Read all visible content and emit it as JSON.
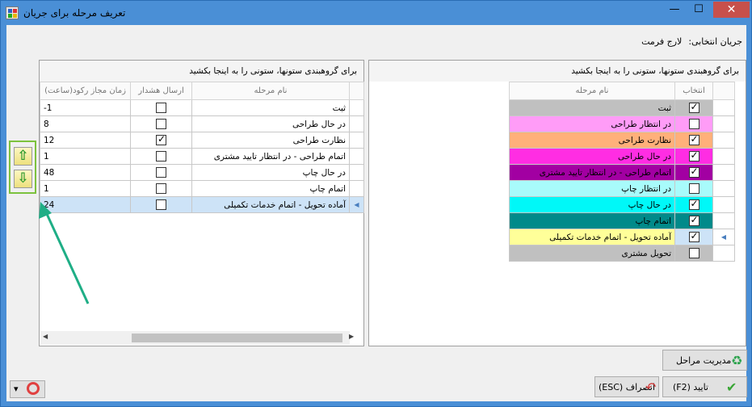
{
  "window": {
    "title": "تعریف مرحله برای جریان",
    "minimize_glyph": "—",
    "maximize_glyph": "☐",
    "close_glyph": "✕"
  },
  "flow": {
    "label": "جریان انتخابی:",
    "value": "لارج فرمت"
  },
  "left_grid": {
    "group_hint": "برای گروهبندی ستونها، ستونی را به اینجا بکشید",
    "columns": [
      "زمان مجاز رکود(ساعت)",
      "ارسال هشدار",
      "نام مرحله"
    ],
    "rows": [
      {
        "time": "-1",
        "alert": false,
        "name": "ثبت"
      },
      {
        "time": "8",
        "alert": false,
        "name": "در حال طراحی"
      },
      {
        "time": "12",
        "alert": true,
        "name": "نظارت طراحی"
      },
      {
        "time": "1",
        "alert": false,
        "name": "اتمام طراحی - در انتظار تایید مشتری"
      },
      {
        "time": "48",
        "alert": false,
        "name": "در حال چاپ"
      },
      {
        "time": "1",
        "alert": false,
        "name": "اتمام چاپ"
      },
      {
        "time": "24",
        "alert": false,
        "name": "آماده تحویل - اتمام خدمات تکمیلی",
        "selected": true
      }
    ],
    "row_indicator_glyph": "◀",
    "scroll_left_glyph": "◀",
    "scroll_right_glyph": "▶"
  },
  "right_grid": {
    "group_hint": "برای گروهبندی ستونها، ستونی را به اینجا بکشید",
    "columns": [
      "نام مرحله",
      "انتخاب"
    ],
    "rows": [
      {
        "name": "ثبت",
        "checked": true,
        "color": "#c0c0c0"
      },
      {
        "name": "در انتظار طراحی",
        "checked": false,
        "color": "#ff9cf7"
      },
      {
        "name": "نظارت طراحی",
        "checked": true,
        "color": "#ffb07a"
      },
      {
        "name": "در حال طراحی",
        "checked": true,
        "color": "#ff2de3"
      },
      {
        "name": "اتمام طراحی - در انتظار تایید مشتری",
        "checked": true,
        "color": "#a200a2"
      },
      {
        "name": "در انتظار چاپ",
        "checked": false,
        "color": "#a8fbfb"
      },
      {
        "name": "در حال چاپ",
        "checked": true,
        "color": "#00f8f8"
      },
      {
        "name": "اتمام چاپ",
        "checked": true,
        "color": "#008a8a"
      },
      {
        "name": "آماده تحویل - اتمام خدمات تکمیلی",
        "checked": true,
        "color": "#ffff99",
        "selected": true
      },
      {
        "name": "تحویل مشتری",
        "checked": false,
        "color": "#c0c0c0"
      }
    ],
    "row_indicator_glyph": "◀"
  },
  "move_buttons": {
    "up_glyph": "⇧",
    "down_glyph": "⇩"
  },
  "buttons": {
    "manage": "مدیریت مراحل",
    "confirm": "تایید (F2)",
    "cancel": "انصراف (ESC)",
    "settings_glyph": "▾"
  },
  "colors": {
    "title_bar": "#4a8fd6",
    "selected_row": "#cde3f7",
    "highlight_border": "#7cc23e",
    "annotation_arrow": "#1fae86"
  }
}
